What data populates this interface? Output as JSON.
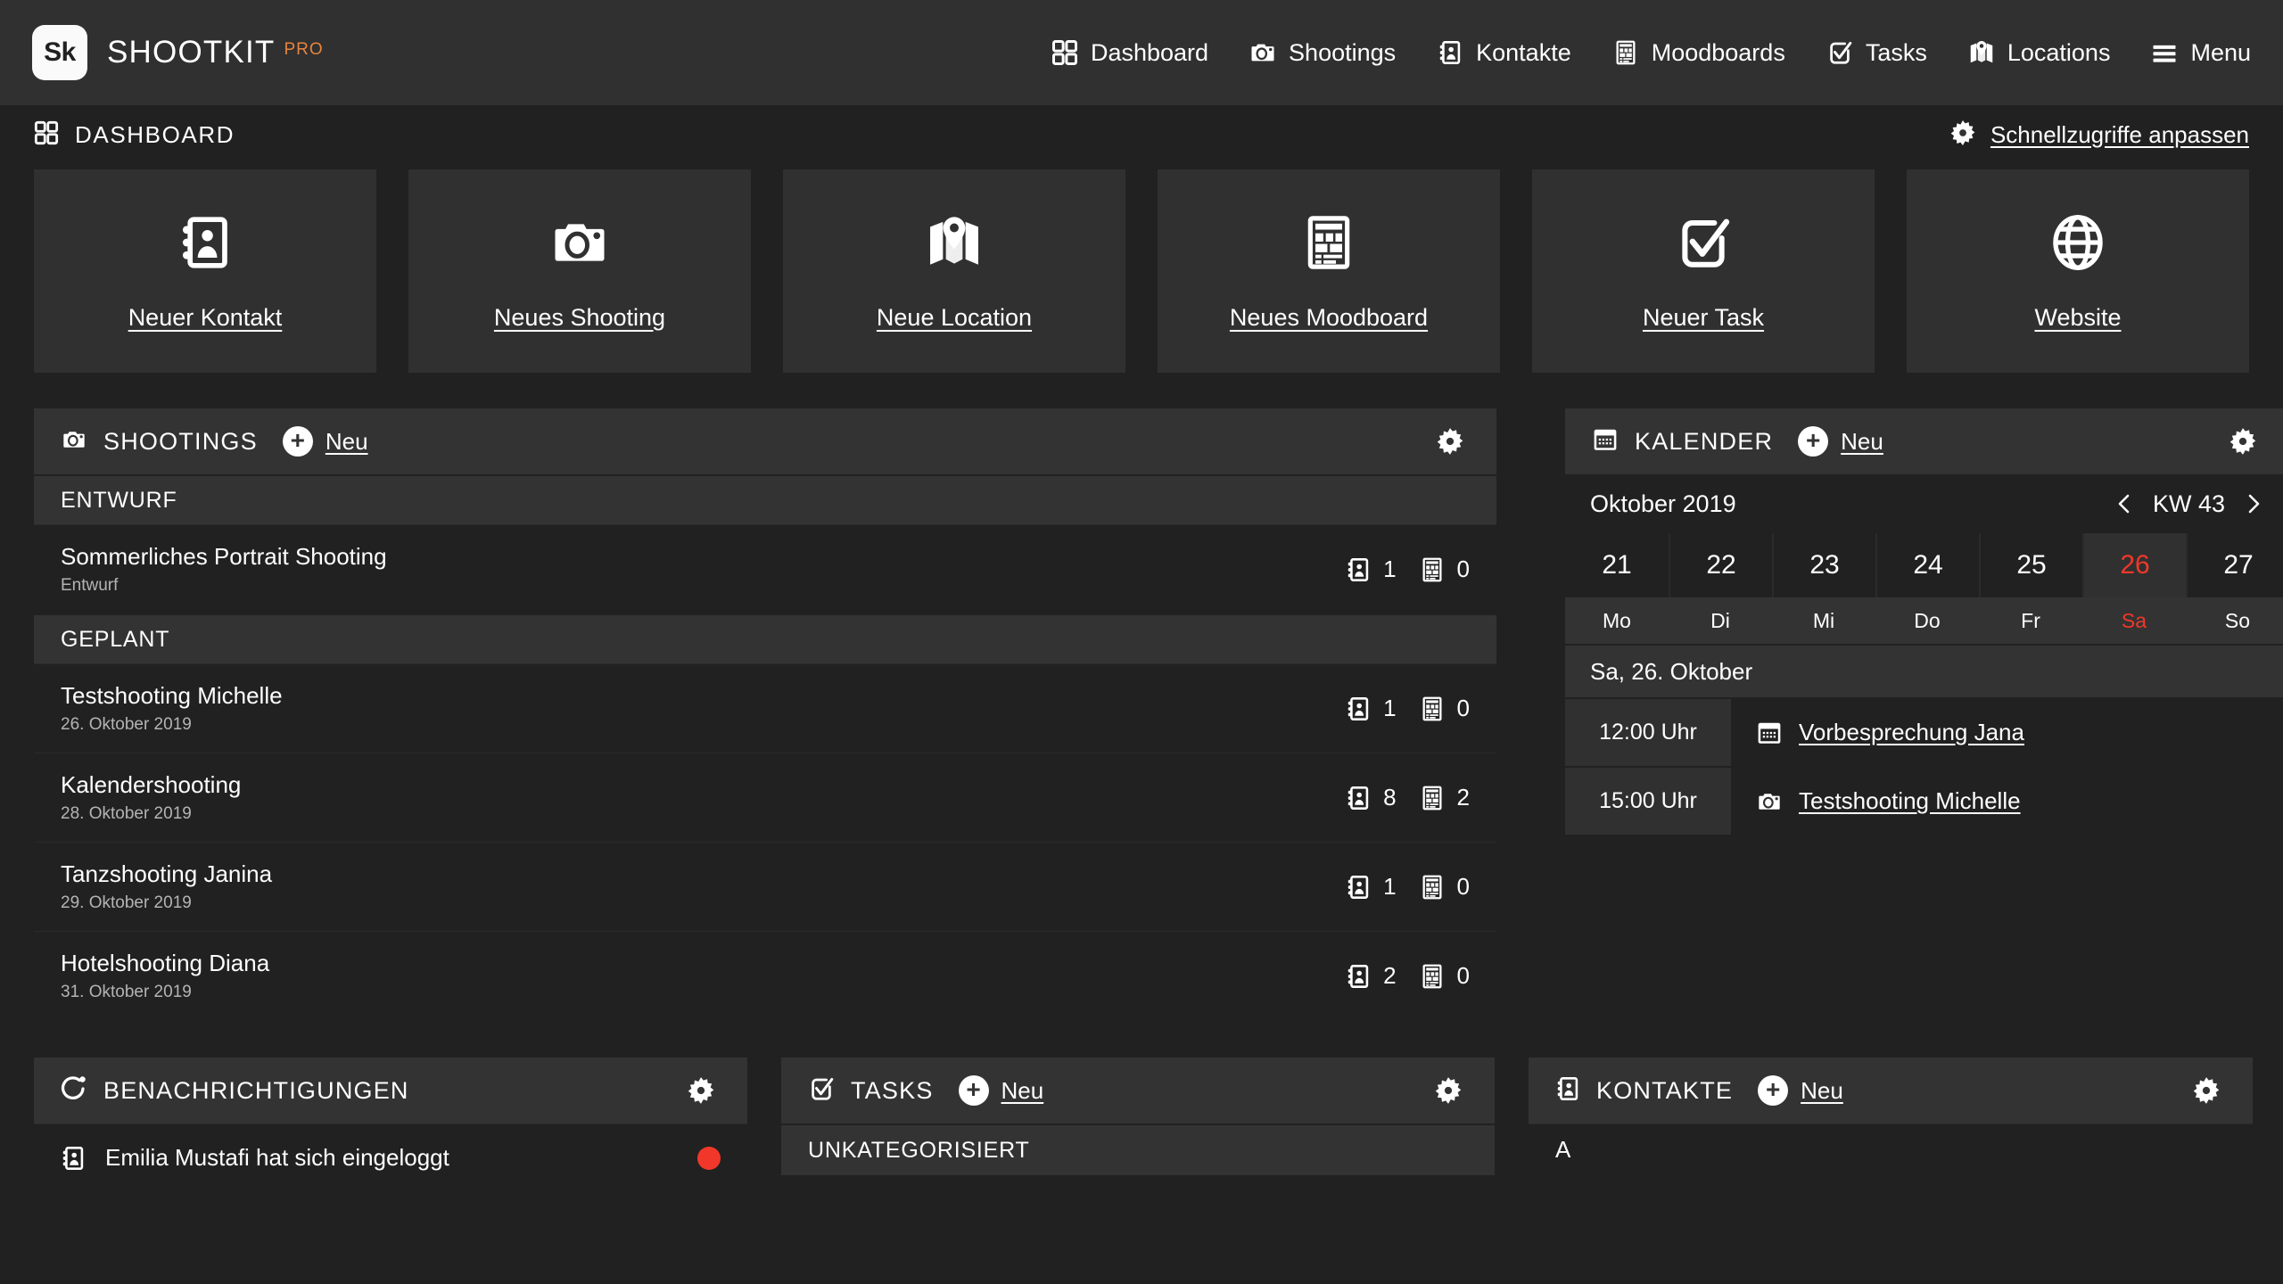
{
  "brand": {
    "badge": "Sk",
    "name": "SHOOTKIT",
    "tag": "PRO"
  },
  "nav": [
    {
      "label": "Dashboard",
      "icon": "grid-icon"
    },
    {
      "label": "Shootings",
      "icon": "camera-icon"
    },
    {
      "label": "Kontakte",
      "icon": "contact-book-icon"
    },
    {
      "label": "Moodboards",
      "icon": "moodboard-icon"
    },
    {
      "label": "Tasks",
      "icon": "check-square-icon"
    },
    {
      "label": "Locations",
      "icon": "map-pin-icon"
    },
    {
      "label": "Menu",
      "icon": "hamburger-icon"
    }
  ],
  "pagehead": {
    "title": "DASHBOARD",
    "icon": "grid-icon",
    "action_label": "Schnellzugriffe anpassen",
    "action_icon": "gear-icon"
  },
  "tiles": [
    {
      "label": "Neuer Kontakt",
      "icon": "contact-book-icon"
    },
    {
      "label": "Neues Shooting",
      "icon": "camera-icon"
    },
    {
      "label": "Neue Location",
      "icon": "map-pin-icon"
    },
    {
      "label": "Neues Moodboard",
      "icon": "moodboard-icon"
    },
    {
      "label": "Neuer Task",
      "icon": "check-square-icon"
    },
    {
      "label": "Website",
      "icon": "globe-icon"
    }
  ],
  "shootings": {
    "title": "SHOOTINGS",
    "icon": "camera-icon",
    "new_label": "Neu",
    "gear_icon": "gear-icon",
    "groups": [
      {
        "label": "ENTWURF",
        "rows": [
          {
            "title": "Sommerliches Portrait Shooting",
            "sub": "Entwurf",
            "contacts": "1",
            "moodboards": "0"
          }
        ]
      },
      {
        "label": "GEPLANT",
        "rows": [
          {
            "title": "Testshooting Michelle",
            "sub": "26. Oktober 2019",
            "contacts": "1",
            "moodboards": "0"
          },
          {
            "title": "Kalendershooting",
            "sub": "28. Oktober 2019",
            "contacts": "8",
            "moodboards": "2"
          },
          {
            "title": "Tanzshooting Janina",
            "sub": "29. Oktober 2019",
            "contacts": "1",
            "moodboards": "0"
          },
          {
            "title": "Hotelshooting Diana",
            "sub": "31. Oktober 2019",
            "contacts": "2",
            "moodboards": "0"
          }
        ]
      }
    ]
  },
  "calendar": {
    "title": "KALENDER",
    "icon": "calendar-icon",
    "new_label": "Neu",
    "gear_icon": "gear-icon",
    "month": "Oktober 2019",
    "week_label": "KW 43",
    "prev_icon": "chevron-left-icon",
    "next_icon": "chevron-right-icon",
    "days": [
      {
        "num": "21",
        "dow": "Mo",
        "today": false
      },
      {
        "num": "22",
        "dow": "Di",
        "today": false
      },
      {
        "num": "23",
        "dow": "Mi",
        "today": false
      },
      {
        "num": "24",
        "dow": "Do",
        "today": false
      },
      {
        "num": "25",
        "dow": "Fr",
        "today": false
      },
      {
        "num": "26",
        "dow": "Sa",
        "today": true
      },
      {
        "num": "27",
        "dow": "So",
        "today": false
      }
    ],
    "selected_day_label": "Sa, 26. Oktober",
    "events": [
      {
        "time": "12:00 Uhr",
        "label": "Vorbesprechung Jana",
        "icon": "calendar-icon"
      },
      {
        "time": "15:00 Uhr",
        "label": "Testshooting Michelle",
        "icon": "camera-icon"
      }
    ]
  },
  "notifications": {
    "title": "BENACHRICHTIGUNGEN",
    "icon": "bell-icon",
    "gear_icon": "gear-icon",
    "rows": [
      {
        "text": "Emilia Mustafi hat sich eingeloggt",
        "icon": "contact-book-icon",
        "unread": true
      }
    ]
  },
  "tasks": {
    "title": "TASKS",
    "icon": "check-square-icon",
    "new_label": "Neu",
    "gear_icon": "gear-icon",
    "group_label": "UNKATEGORISIERT"
  },
  "contacts": {
    "title": "KONTAKTE",
    "icon": "contact-book-icon",
    "new_label": "Neu",
    "gear_icon": "gear-icon",
    "letter": "A"
  },
  "colors": {
    "bg": "#212121",
    "panel": "#303030",
    "panel_head": "#333333",
    "accent_orange": "#e8843c",
    "accent_red": "#f1372a",
    "text": "#ffffff",
    "muted": "#b4b4b4"
  }
}
